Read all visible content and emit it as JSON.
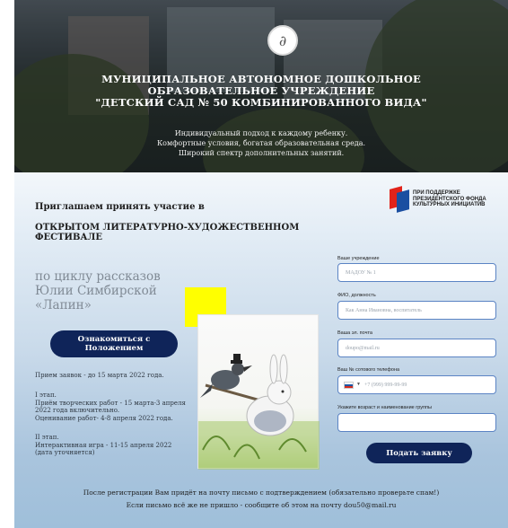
{
  "hero": {
    "logo_glyph": "∂",
    "title_lines": [
      "МУНИЦИПАЛЬНОЕ АВТОНОМНОЕ ДОШКОЛЬНОЕ",
      "ОБРАЗОВАТЕЛЬНОЕ УЧРЕЖДЕНИЕ",
      "\"ДЕТСКИЙ САД № 50 КОМБИНИРОВАННОГО ВИДА\""
    ],
    "tagline": [
      "Индивидуальный подход к каждому ребенку.",
      "Комфортные условия, богатая образовательная среда.",
      "Широкий спектр дополнительных занятий."
    ]
  },
  "invite": "Приглашаем принять участие в",
  "festival": [
    "ОТКРЫТОМ ЛИТЕРАТУРНО-ХУДОЖЕСТВЕННОМ",
    "ФЕСТИВАЛЕ"
  ],
  "series": [
    "по циклу рассказов",
    "Юлии Симбирской",
    "«Лапин»"
  ],
  "cta": [
    "Ознакомиться с",
    "Положением"
  ],
  "info": {
    "deadline": "Прием заявок - до 15 марта 2022 года.",
    "stage1": [
      "I этап.",
      "Приём творческих работ - 15 марта-3 апреля",
      "2022 года включительно.",
      "Оценивание работ- 4-8 апреля 2022 года."
    ],
    "stage2": [
      "II этап.",
      "Интерактивная игра - 11-15 апреля 2022",
      "(дата уточняется)"
    ]
  },
  "fund": [
    "ПРИ ПОДДЕРЖКЕ",
    "ПРЕЗИДЕНТСКОГО ФОНДА",
    "КУЛЬТУРНЫХ ИНИЦИАТИВ"
  ],
  "form": {
    "fields": [
      {
        "label": "Ваше учреждение",
        "placeholder": "МАДОУ № 1"
      },
      {
        "label": "ФИО, должность",
        "placeholder": "Как Анна Ивановна, воспитатель"
      },
      {
        "label": "Ваша эл. почта",
        "placeholder": "doupo@mail.ru"
      },
      {
        "label": "Ваш № сотового телефона",
        "placeholder": "+7 (999) 999-99-99"
      },
      {
        "label": "Укажите возраст и наименование группы",
        "placeholder": ""
      }
    ],
    "submit": "Подать заявку"
  },
  "footer": [
    "После регистрации Вам придёт на почту письмо с подтверждением (обязательно проверьте спам!)",
    "Если письмо всё же не пришло - сообщите об этом на почту dou50@mail.ru"
  ],
  "colors": {
    "primary": "#0f2459",
    "accent_yellow": "#ffff00",
    "input_border": "#5b84c4"
  }
}
